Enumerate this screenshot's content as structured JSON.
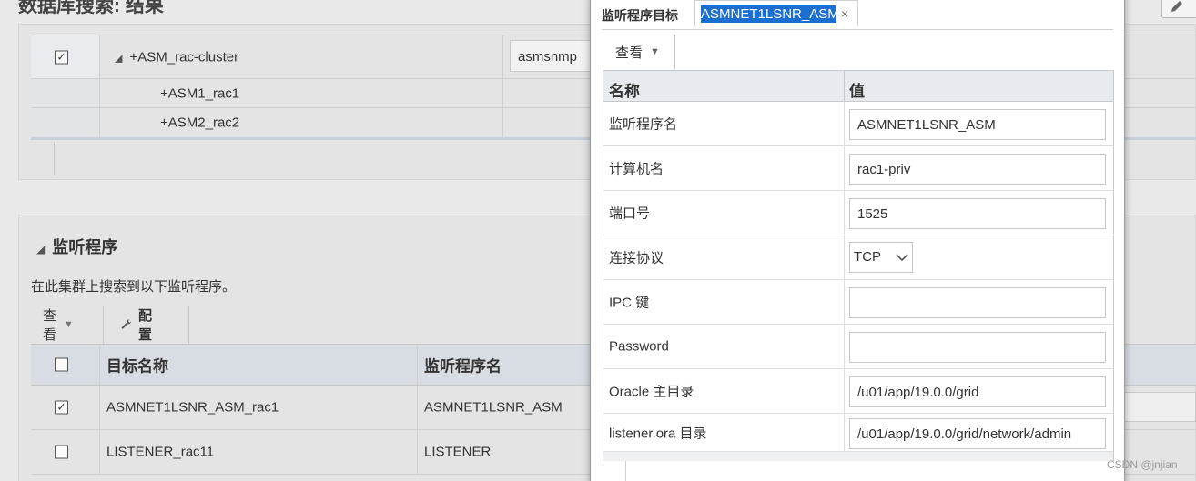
{
  "background": {
    "title": "数据库搜索: 结果",
    "cluster_table": {
      "rows": [
        {
          "name": "+ASM_rac-cluster",
          "checked": true,
          "value": "asmsnmp"
        },
        {
          "name": "+ASM1_rac1"
        },
        {
          "name": "+ASM2_rac2"
        }
      ]
    },
    "listener_section": {
      "title": "监听程序",
      "description": "在此集群上搜索到以下监听程序。",
      "toolbar": {
        "view_label": "查看",
        "configure_label": "配置"
      },
      "table": {
        "headers": [
          "目标名称",
          "监听程序名"
        ],
        "rows": [
          {
            "target": "ASMNET1LSNR_ASM_rac1",
            "listener": "ASMNET1LSNR_ASM",
            "checked": true
          },
          {
            "target": "LISTENER_rac11",
            "listener": "LISTENER",
            "checked": false
          }
        ]
      }
    }
  },
  "dialog": {
    "tab_label": "监听程序目标",
    "tab_value": "ASMNET1LSNR_ASM",
    "toolbar": {
      "view_label": "查看"
    },
    "table": {
      "header_name": "名称",
      "header_value": "值",
      "rows": [
        {
          "name": "监听程序名",
          "value": "ASMNET1LSNR_ASM"
        },
        {
          "name": "计算机名",
          "value": "rac1-priv"
        },
        {
          "name": "端口号",
          "value": "1525"
        },
        {
          "name": "连接协议",
          "value": "TCP"
        },
        {
          "name": "IPC 键",
          "value": ""
        },
        {
          "name": "Password",
          "value": ""
        },
        {
          "name": "Oracle 主目录",
          "value": "/u01/app/19.0.0/grid"
        },
        {
          "name": "listener.ora 目录",
          "value": "/u01/app/19.0.0/grid/network/admin"
        }
      ]
    }
  },
  "watermark": "CSDN @jnjian",
  "colors": {
    "selection": "#1a6fd1",
    "header_bg": "#e7eaee"
  }
}
